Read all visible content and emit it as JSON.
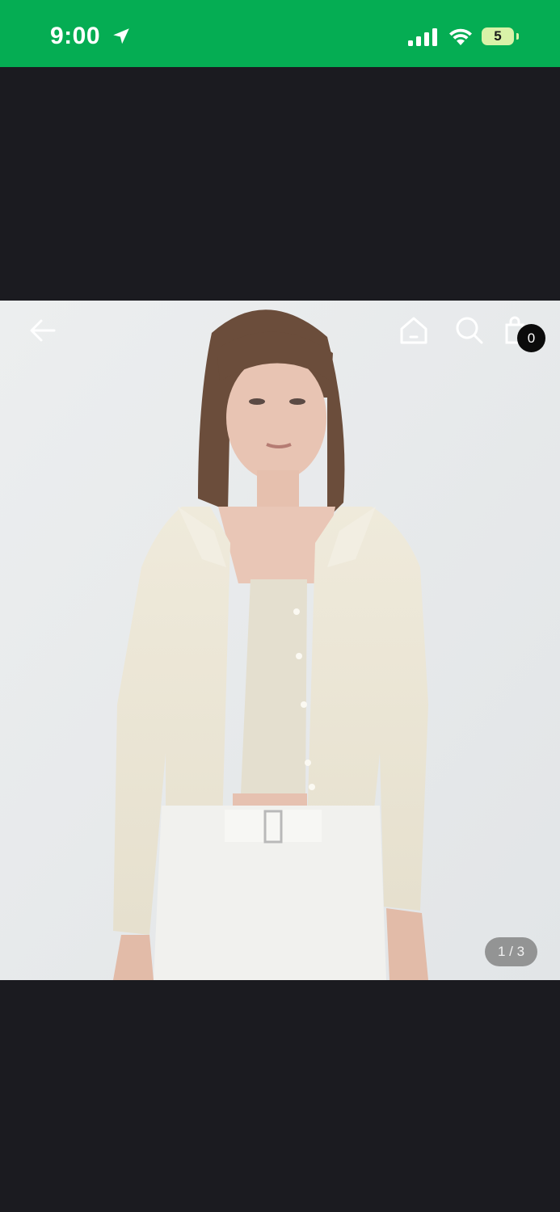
{
  "status_bar": {
    "time": "9:00",
    "battery_level": "5",
    "background_color": "#05ad53",
    "icons": [
      "location-arrow-icon",
      "cellular-signal-icon",
      "wifi-icon",
      "battery-icon"
    ]
  },
  "product_viewer": {
    "image_description_icon": "product-photo",
    "pager": {
      "current": 1,
      "total": 3,
      "text": "1 / 3"
    }
  },
  "toolbar": {
    "back_icon": "arrow-left-icon",
    "home_icon": "home-icon",
    "search_icon": "search-icon",
    "bag_icon": "shopping-bag-icon",
    "cart_count": "0"
  }
}
